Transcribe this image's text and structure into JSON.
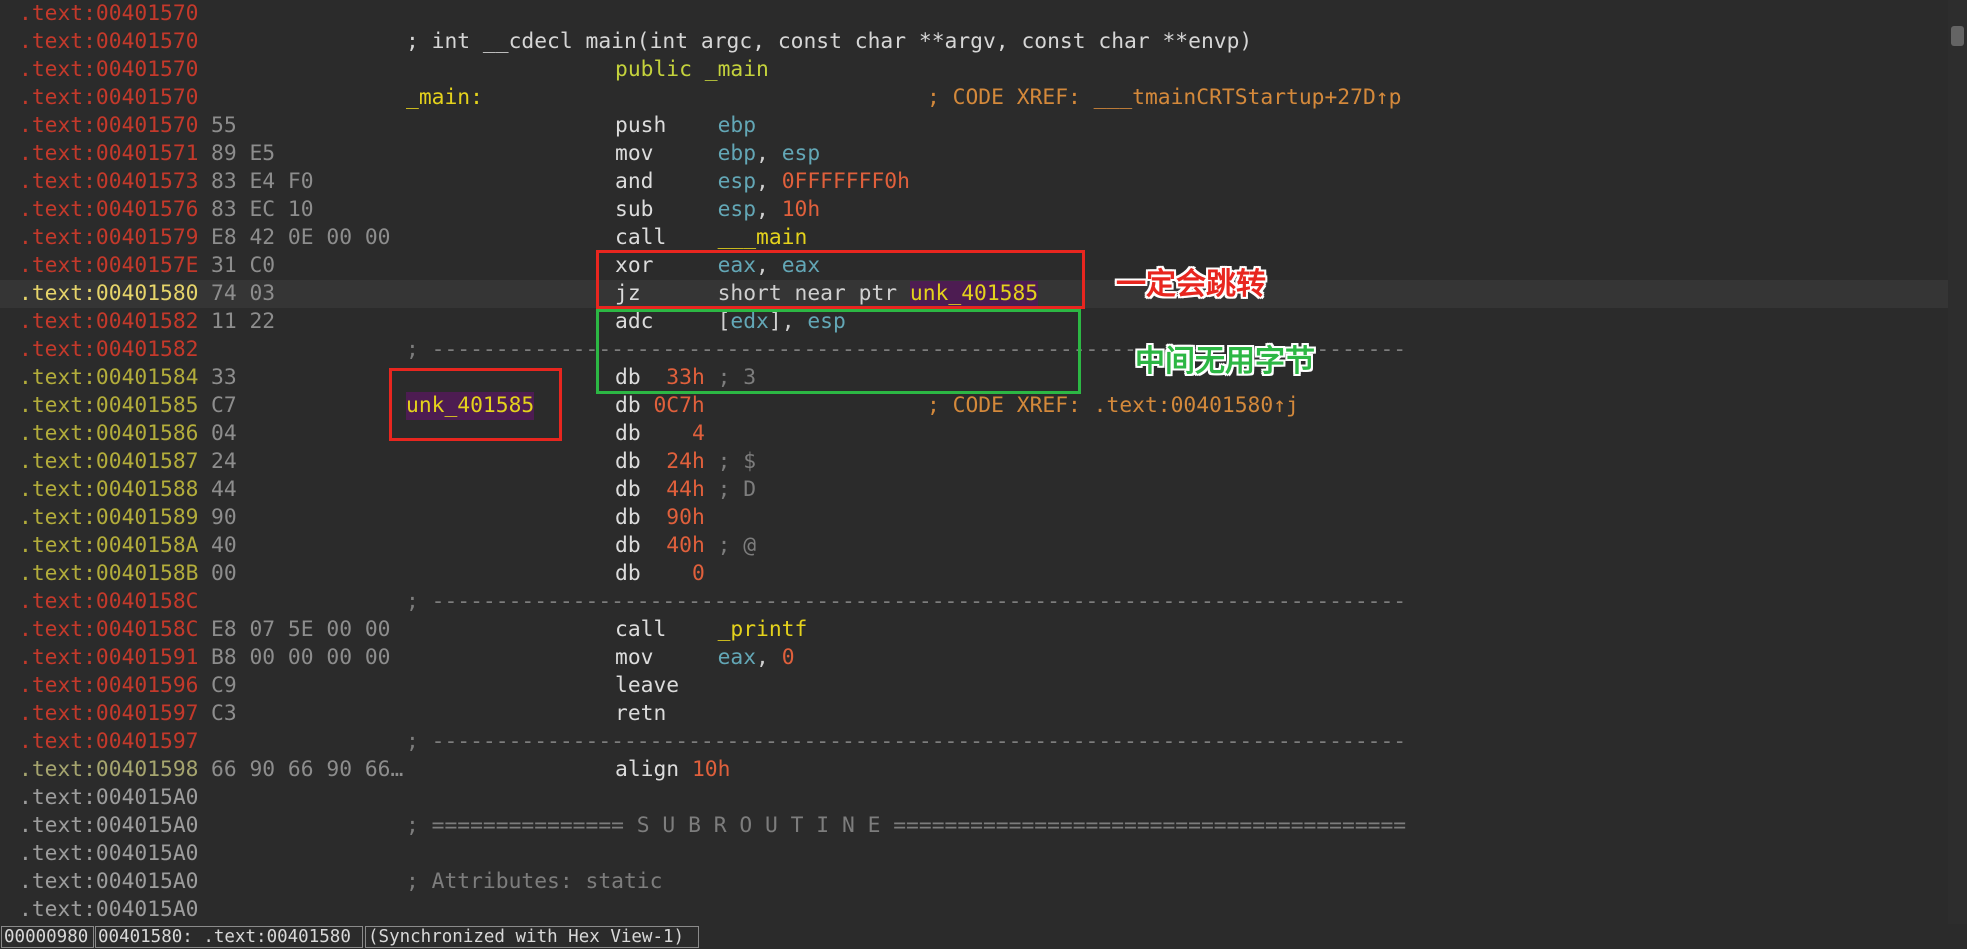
{
  "theme": {
    "background": "#2b2b2b",
    "current_line": "#353535",
    "address_code": "#c4392b",
    "address_data": "#b3ad3b",
    "address_current": "#e6d46a",
    "address_align": "#a6a56f",
    "address_unexplored": "#9d9d9d",
    "bytes": "#8d8d8d",
    "mnemonic": "#dcdcdc",
    "register": "#63a7b6",
    "number": "#e0603c",
    "symbol": "#e4d21c",
    "symbol_highlight": "#4d1c52",
    "directive": "#c4d23c",
    "comment": "#7d7d7d",
    "prototype": "#d6d6d6",
    "xref": "#d4893b",
    "annotation_red": "#e8261f",
    "annotation_green": "#2cb744"
  },
  "listing": [
    {
      "addr": ".text:00401570",
      "kind": "code"
    },
    {
      "addr": ".text:00401570",
      "kind": "code",
      "note": "; int __cdecl main(int argc, const char **argv, const char **envp)",
      "note_kind": "proto"
    },
    {
      "addr": ".text:00401570",
      "kind": "code",
      "asm": [
        [
          "public _main",
          "k"
        ]
      ]
    },
    {
      "addr": ".text:00401570",
      "kind": "code",
      "label": "_main:",
      "xref": "; CODE XREF: ___tmainCRTStartup+27D↑p"
    },
    {
      "addr": ".text:00401570",
      "kind": "code",
      "bytes": "55",
      "asm": [
        [
          "push    ",
          "m"
        ],
        [
          "ebp",
          "r"
        ]
      ]
    },
    {
      "addr": ".text:00401571",
      "kind": "code",
      "bytes": "89 E5",
      "asm": [
        [
          "mov     ",
          "m"
        ],
        [
          "ebp",
          "r"
        ],
        [
          ", ",
          "p"
        ],
        [
          "esp",
          "r"
        ]
      ]
    },
    {
      "addr": ".text:00401573",
      "kind": "code",
      "bytes": "83 E4 F0",
      "asm": [
        [
          "and     ",
          "m"
        ],
        [
          "esp",
          "r"
        ],
        [
          ", ",
          "p"
        ],
        [
          "0FFFFFFF0h",
          "n"
        ]
      ]
    },
    {
      "addr": ".text:00401576",
      "kind": "code",
      "bytes": "83 EC 10",
      "asm": [
        [
          "sub     ",
          "m"
        ],
        [
          "esp",
          "r"
        ],
        [
          ", ",
          "p"
        ],
        [
          "10h",
          "n"
        ]
      ]
    },
    {
      "addr": ".text:00401579",
      "kind": "code",
      "bytes": "E8 42 0E 00 00",
      "asm": [
        [
          "call    ",
          "m"
        ],
        [
          "___main",
          "s"
        ]
      ]
    },
    {
      "addr": ".text:0040157E",
      "kind": "code",
      "bytes": "31 C0",
      "asm": [
        [
          "xor     ",
          "m"
        ],
        [
          "eax",
          "r"
        ],
        [
          ", ",
          "p"
        ],
        [
          "eax",
          "r"
        ]
      ]
    },
    {
      "addr": ".text:00401580",
      "kind": "current",
      "current": true,
      "bytes": "74 03",
      "asm": [
        [
          "jz      ",
          "m"
        ],
        [
          "short near ptr ",
          "p"
        ],
        [
          "unk_401585",
          "h"
        ]
      ]
    },
    {
      "addr": ".text:00401582",
      "kind": "code",
      "bytes": "11 22",
      "asm": [
        [
          "adc     ",
          "m"
        ],
        [
          "[",
          "p"
        ],
        [
          "edx",
          "r"
        ],
        [
          "], ",
          "p"
        ],
        [
          "esp",
          "r"
        ]
      ]
    },
    {
      "addr": ".text:00401582",
      "kind": "code",
      "note": "; ----------------------------------------------------------------------------",
      "note_kind": "sep"
    },
    {
      "addr": ".text:00401584",
      "kind": "data",
      "bytes": "33",
      "asm": [
        [
          "db  ",
          "m"
        ],
        [
          "33h",
          "n"
        ],
        [
          " ; 3",
          "c"
        ]
      ]
    },
    {
      "addr": ".text:00401585",
      "kind": "data",
      "bytes": "C7",
      "label": "unk_401585",
      "label_hl": true,
      "asm": [
        [
          "db ",
          "m"
        ],
        [
          "0C7h",
          "n"
        ]
      ],
      "xref": "; CODE XREF: .text:00401580↑j"
    },
    {
      "addr": ".text:00401586",
      "kind": "data",
      "bytes": "04",
      "asm": [
        [
          "db    ",
          "m"
        ],
        [
          "4",
          "n"
        ]
      ]
    },
    {
      "addr": ".text:00401587",
      "kind": "data",
      "bytes": "24",
      "asm": [
        [
          "db  ",
          "m"
        ],
        [
          "24h",
          "n"
        ],
        [
          " ; $",
          "c"
        ]
      ]
    },
    {
      "addr": ".text:00401588",
      "kind": "data",
      "bytes": "44",
      "asm": [
        [
          "db  ",
          "m"
        ],
        [
          "44h",
          "n"
        ],
        [
          " ; D",
          "c"
        ]
      ]
    },
    {
      "addr": ".text:00401589",
      "kind": "data",
      "bytes": "90",
      "asm": [
        [
          "db  ",
          "m"
        ],
        [
          "90h",
          "n"
        ]
      ]
    },
    {
      "addr": ".text:0040158A",
      "kind": "data",
      "bytes": "40",
      "asm": [
        [
          "db  ",
          "m"
        ],
        [
          "40h",
          "n"
        ],
        [
          " ; @",
          "c"
        ]
      ]
    },
    {
      "addr": ".text:0040158B",
      "kind": "data",
      "bytes": "00",
      "asm": [
        [
          "db    ",
          "m"
        ],
        [
          "0",
          "n"
        ]
      ]
    },
    {
      "addr": ".text:0040158C",
      "kind": "code",
      "note": "; ----------------------------------------------------------------------------",
      "note_kind": "sep"
    },
    {
      "addr": ".text:0040158C",
      "kind": "code",
      "bytes": "E8 07 5E 00 00",
      "asm": [
        [
          "call    ",
          "m"
        ],
        [
          "_printf",
          "s"
        ]
      ]
    },
    {
      "addr": ".text:00401591",
      "kind": "code",
      "bytes": "B8 00 00 00 00",
      "asm": [
        [
          "mov     ",
          "m"
        ],
        [
          "eax",
          "r"
        ],
        [
          ", ",
          "p"
        ],
        [
          "0",
          "n"
        ]
      ]
    },
    {
      "addr": ".text:00401596",
      "kind": "code",
      "bytes": "C9",
      "asm": [
        [
          "leave",
          "m"
        ]
      ]
    },
    {
      "addr": ".text:00401597",
      "kind": "code",
      "bytes": "C3",
      "asm": [
        [
          "retn",
          "m"
        ]
      ]
    },
    {
      "addr": ".text:00401597",
      "kind": "code",
      "note": "; ----------------------------------------------------------------------------",
      "note_kind": "sep"
    },
    {
      "addr": ".text:00401598",
      "kind": "align",
      "bytes": "66 90 66 90 66…",
      "asm": [
        [
          "align ",
          "m"
        ],
        [
          "10h",
          "n"
        ]
      ]
    },
    {
      "addr": ".text:004015A0",
      "kind": "unexplored"
    },
    {
      "addr": ".text:004015A0",
      "kind": "unexplored",
      "note": "; =============== S U B R O U T I N E ========================================",
      "note_kind": "banner"
    },
    {
      "addr": ".text:004015A0",
      "kind": "unexplored"
    },
    {
      "addr": ".text:004015A0",
      "kind": "unexplored",
      "note": "; Attributes: static",
      "note_kind": "comment"
    },
    {
      "addr": ".text:004015A0",
      "kind": "unexplored"
    }
  ],
  "annotations": {
    "always_jumps": "一定会跳转",
    "junk_bytes": "中间无用字节"
  },
  "status_bar": {
    "file_offset": "00000980",
    "location": "00401580: .text:00401580",
    "sync": "(Synchronized with Hex View-1)"
  }
}
